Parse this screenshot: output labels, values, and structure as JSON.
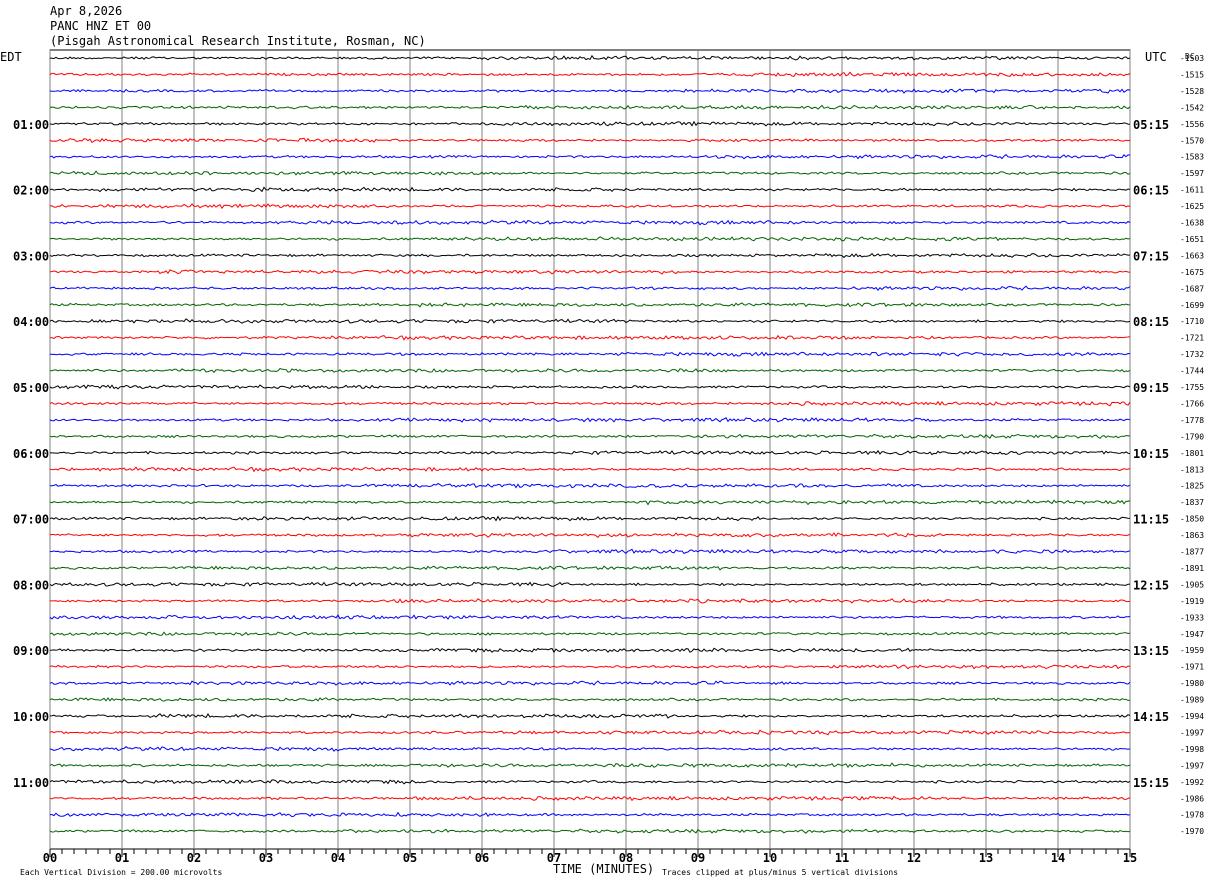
{
  "header": {
    "date": "Apr 8,2026",
    "station": "PANC HNZ ET 00",
    "site": "(Pisgah Astronomical Research Institute, Rosman, NC)"
  },
  "chart_data": {
    "type": "line",
    "title": "Apr 8,2026",
    "left_axis_title": "EDT",
    "right_axis_title": "UTC",
    "dc_title": "DC",
    "xlabel": "TIME (MINUTES)",
    "xlim": [
      0,
      15
    ],
    "x_ticks": [
      "00",
      "01",
      "02",
      "03",
      "04",
      "05",
      "06",
      "07",
      "08",
      "09",
      "10",
      "11",
      "12",
      "13",
      "14",
      "15"
    ],
    "left_hour_labels": [
      "01:00",
      "02:00",
      "03:00",
      "04:00",
      "05:00",
      "06:00",
      "07:00",
      "08:00",
      "09:00",
      "10:00",
      "11:00"
    ],
    "right_hour_labels": [
      "05:15",
      "06:15",
      "07:15",
      "08:15",
      "09:15",
      "10:15",
      "11:15",
      "12:15",
      "13:15",
      "14:15",
      "15:15"
    ],
    "trace_colors": [
      "#000000",
      "#ff0000",
      "#0000ff",
      "#006400"
    ],
    "grid": true,
    "dc_offsets": [
      -1503,
      -1515,
      -1528,
      -1542,
      -1556,
      -1570,
      -1583,
      -1597,
      -1611,
      -1625,
      -1638,
      -1651,
      -1663,
      -1675,
      -1687,
      -1699,
      -1710,
      -1721,
      -1732,
      -1744,
      -1755,
      -1766,
      -1778,
      -1790,
      -1801,
      -1813,
      -1825,
      -1837,
      -1850,
      -1863,
      -1877,
      -1891,
      -1905,
      -1919,
      -1933,
      -1947,
      -1959,
      -1971,
      -1980,
      -1989,
      -1994,
      -1997,
      -1998,
      -1997,
      -1992,
      -1986,
      -1978,
      -1970
    ],
    "footer_scale": "Each Vertical Division =  200.00 microvolts",
    "footer_clip": "Traces clipped at plus/minus 5 vertical divisions"
  }
}
